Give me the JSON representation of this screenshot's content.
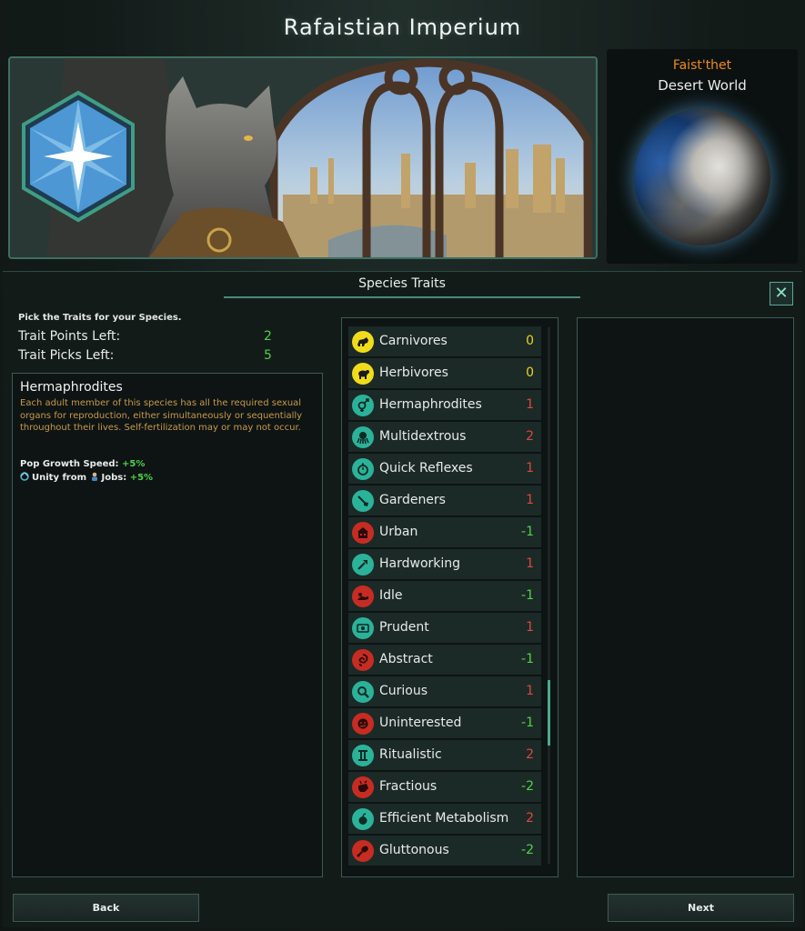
{
  "empire": {
    "title": "Rafaistian Imperium"
  },
  "planet": {
    "name": "Faist'thet",
    "type": "Desert World"
  },
  "panel": {
    "header": "Species Traits",
    "close_symbol": "✕",
    "pick_hint": "Pick the Traits for your Species.",
    "points_label": "Trait Points Left:",
    "points_value": "2",
    "picks_label": "Trait Picks Left:",
    "picks_value": "5"
  },
  "description": {
    "title": "Hermaphrodites",
    "text": "Each adult member of this species has all the required sexual organs for reproduction, either simultaneously or sequentially throughout their lives. Self-fertilization may or may not occur.",
    "effect1_label": "Pop Growth Speed:",
    "effect1_value": "+5%",
    "effect2_prefix": "Unity from",
    "effect2_label": "Jobs:",
    "effect2_value": "+5%"
  },
  "colors": {
    "positive": "#4fd24a",
    "negative": "#e0463c",
    "neutral": "#e8d31e",
    "icon_yellow": "#f1dc1b",
    "icon_teal": "#2bb39a",
    "icon_red": "#c72c22"
  },
  "traits": [
    {
      "name": "Carnivores",
      "cost": "0",
      "icon": "carnivore-icon",
      "kind": "neutral"
    },
    {
      "name": "Herbivores",
      "cost": "0",
      "icon": "herbivore-icon",
      "kind": "neutral"
    },
    {
      "name": "Hermaphrodites",
      "cost": "1",
      "icon": "hermaphrodite-icon",
      "kind": "good"
    },
    {
      "name": "Multidextrous",
      "cost": "2",
      "icon": "octopus-icon",
      "kind": "good"
    },
    {
      "name": "Quick Reflexes",
      "cost": "1",
      "icon": "stopwatch-icon",
      "kind": "good"
    },
    {
      "name": "Gardeners",
      "cost": "1",
      "icon": "shovel-icon",
      "kind": "good"
    },
    {
      "name": "Urban",
      "cost": "-1",
      "icon": "building-icon",
      "kind": "bad"
    },
    {
      "name": "Hardworking",
      "cost": "1",
      "icon": "hammer-icon",
      "kind": "good"
    },
    {
      "name": "Idle",
      "cost": "-1",
      "icon": "lounging-icon",
      "kind": "bad"
    },
    {
      "name": "Prudent",
      "cost": "1",
      "icon": "money-icon",
      "kind": "good"
    },
    {
      "name": "Abstract",
      "cost": "-1",
      "icon": "swirl-icon",
      "kind": "bad"
    },
    {
      "name": "Curious",
      "cost": "1",
      "icon": "magnifier-icon",
      "kind": "good"
    },
    {
      "name": "Uninterested",
      "cost": "-1",
      "icon": "bored-face-icon",
      "kind": "bad"
    },
    {
      "name": "Ritualistic",
      "cost": "2",
      "icon": "pillar-icon",
      "kind": "good"
    },
    {
      "name": "Fractious",
      "cost": "-2",
      "icon": "fist-icon",
      "kind": "bad"
    },
    {
      "name": "Efficient Metabolism",
      "cost": "2",
      "icon": "apple-icon",
      "kind": "good"
    },
    {
      "name": "Gluttonous",
      "cost": "-2",
      "icon": "drumstick-icon",
      "kind": "bad"
    }
  ],
  "buttons": {
    "back": "Back",
    "next": "Next"
  }
}
